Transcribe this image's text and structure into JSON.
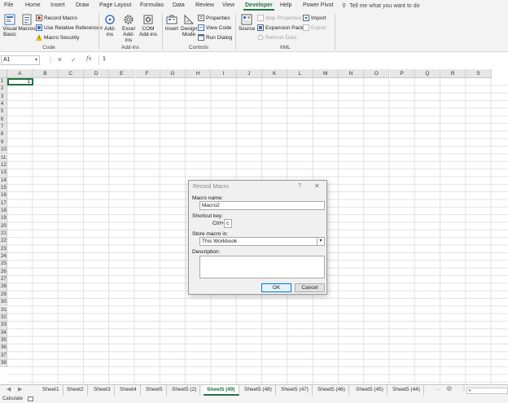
{
  "ribbon_tabs": [
    "File",
    "Home",
    "Insert",
    "Draw",
    "Page Layout",
    "Formulas",
    "Data",
    "Review",
    "View",
    "Developer",
    "Help",
    "Power Pivot"
  ],
  "active_tab": "Developer",
  "tell_me": "Tell me what you want to do",
  "groups": {
    "code": {
      "label": "Code",
      "visual_basic": "Visual Basic",
      "macros": "Macros",
      "record_macro": "Record Macro",
      "relative_refs": "Use Relative References",
      "macro_security": "Macro Security"
    },
    "addins": {
      "label": "Add-ins",
      "addins": "Add-ins",
      "excel_addins": "Excel Add-ins",
      "com_addins": "COM Add-ins"
    },
    "controls": {
      "label": "Controls",
      "insert": "Insert",
      "design_mode": "Design Mode",
      "properties": "Properties",
      "view_code": "View Code",
      "run_dialog": "Run Dialog"
    },
    "xml": {
      "label": "XML",
      "source": "Source",
      "map_properties": "Map Properties",
      "expansion_packs": "Expansion Packs",
      "refresh_data": "Refresh Data",
      "import": "Import",
      "export": "Export"
    }
  },
  "formula_bar": {
    "name_box": "A1",
    "fx": "fx",
    "value": "1"
  },
  "columns": [
    "A",
    "B",
    "C",
    "D",
    "E",
    "F",
    "G",
    "H",
    "I",
    "J",
    "K",
    "L",
    "M",
    "N",
    "O",
    "P",
    "Q",
    "R",
    "S"
  ],
  "rows": [
    "1",
    "2",
    "3",
    "4",
    "5",
    "6",
    "7",
    "8",
    "9",
    "10",
    "11",
    "12",
    "13",
    "14",
    "15",
    "16",
    "17",
    "18",
    "19",
    "20",
    "21",
    "22",
    "23",
    "24",
    "25",
    "26",
    "27",
    "28",
    "29",
    "30",
    "31",
    "32",
    "33",
    "34",
    "35",
    "36",
    "37",
    "38"
  ],
  "cell_a1": "1",
  "dialog": {
    "title": "Record Macro",
    "help": "?",
    "macro_name_label": "Macro name:",
    "macro_name_value": "Macro2",
    "shortcut_label": "Shortcut key:",
    "ctrl_label": "Ctrl+",
    "shortcut_value": "c",
    "store_label": "Store macro in:",
    "store_value": "This Workbook",
    "description_label": "Description:",
    "description_value": "",
    "ok": "OK",
    "cancel": "Cancel"
  },
  "sheet_tabs": [
    "Sheet1",
    "Sheet2",
    "Sheet3",
    "Sheet4",
    "Sheet5",
    "Sheet5 (2)",
    "Sheet5 (49)",
    "Sheet5 (48)",
    "Sheet5 (47)",
    "Sheet5 (46)",
    "Sheet5 (45)",
    "Sheet5 (44)"
  ],
  "active_sheet": "Sheet5 (49)",
  "sheet_more": "...",
  "status": "Calculate",
  "colors": {
    "excel_green": "#217346",
    "ribbon_bg": "#f3f3f3",
    "header_bg": "#e6e6e6"
  }
}
